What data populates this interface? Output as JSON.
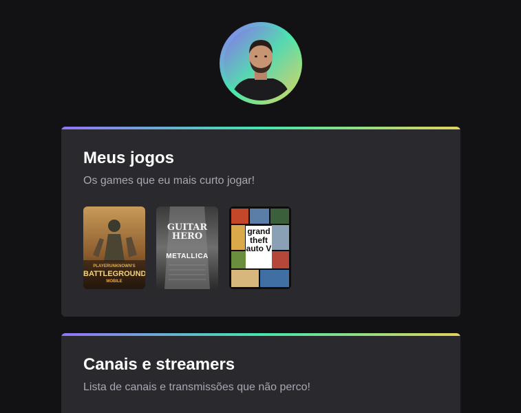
{
  "profile": {
    "avatar_alt": "profile-photo"
  },
  "games_section": {
    "title": "Meus jogos",
    "subtitle": "Os games que eu mais curto jogar!",
    "games": [
      {
        "name": "BATTLEGROUNDS",
        "sub": "MOBILE",
        "top": "PLAYERUNKNOWN'S"
      },
      {
        "name": "METALLICA",
        "top": "GUITAR HERO"
      },
      {
        "name": "grand theft auto V"
      }
    ]
  },
  "channels_section": {
    "title": "Canais e streamers",
    "subtitle": "Lista de canais e transmissões que não perco!"
  },
  "colors": {
    "background": "#121214",
    "card": "#29292e",
    "gradient_start": "#9572fc",
    "gradient_mid": "#43e7ad",
    "gradient_end": "#e2d45c",
    "title": "#ffffff",
    "subtitle": "#a8a8b3"
  }
}
